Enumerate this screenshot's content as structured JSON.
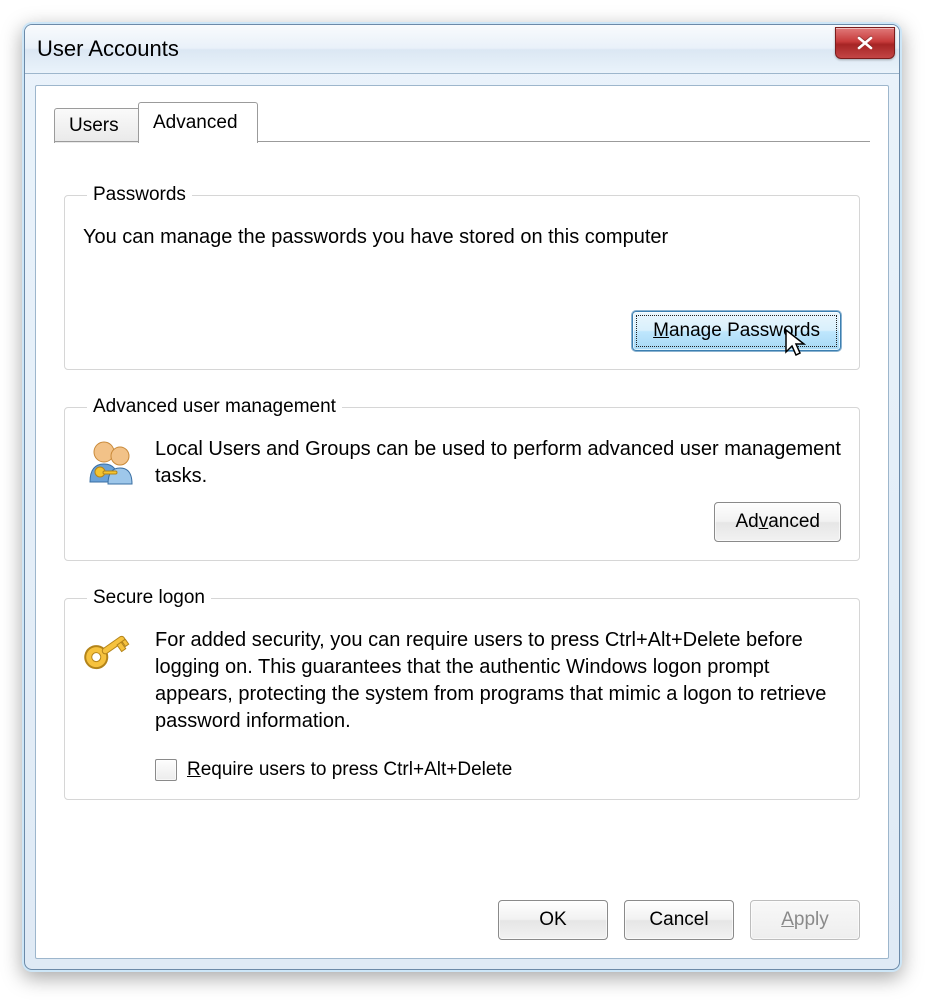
{
  "window": {
    "title": "User Accounts"
  },
  "tabs": {
    "users": "Users",
    "advanced": "Advanced"
  },
  "groups": {
    "passwords": {
      "legend": "Passwords",
      "desc": "You can manage the passwords you have stored on this computer",
      "button_pre": "",
      "button_mn": "M",
      "button_rest": "anage Passwords"
    },
    "advmgmt": {
      "legend": "Advanced user management",
      "desc": "Local Users and Groups can be used to perform advanced user management tasks.",
      "button_pre": "Ad",
      "button_mn": "v",
      "button_rest": "anced"
    },
    "secure": {
      "legend": "Secure logon",
      "desc": "For added security, you can require users to press Ctrl+Alt+Delete before logging on. This guarantees that the authentic Windows logon prompt appears, protecting the system from programs that mimic a logon to retrieve password information.",
      "checkbox_pre": "",
      "checkbox_mn": "R",
      "checkbox_rest": "equire users to press Ctrl+Alt+Delete",
      "checkbox_checked": false
    }
  },
  "footer": {
    "ok": "OK",
    "cancel": "Cancel",
    "apply_pre": "",
    "apply_mn": "A",
    "apply_rest": "pply"
  }
}
